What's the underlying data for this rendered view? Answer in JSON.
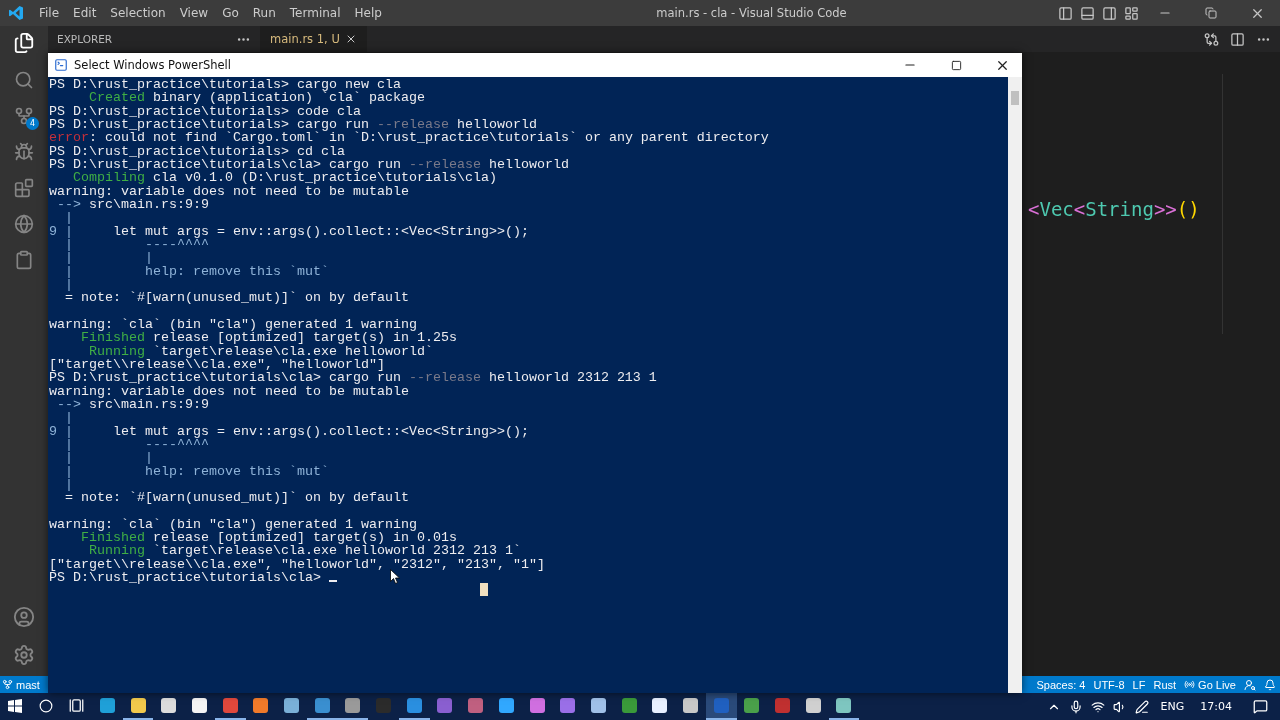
{
  "window": {
    "title": "main.rs - cla - Visual Studio Code"
  },
  "menu": [
    "File",
    "Edit",
    "Selection",
    "View",
    "Go",
    "Run",
    "Terminal",
    "Help"
  ],
  "activity_bar": {
    "source_control_badge": "4"
  },
  "sidebar": {
    "title": "EXPLORER"
  },
  "tabs": [
    {
      "label": "main.rs 1, U",
      "selected": true
    }
  ],
  "editor": {
    "tokens": [
      {
        "text": "<",
        "color": "#da70d6"
      },
      {
        "text": "Vec",
        "color": "#4ec9b0"
      },
      {
        "text": "<",
        "color": "#da70d6"
      },
      {
        "text": "String",
        "color": "#4ec9b0"
      },
      {
        "text": ">>",
        "color": "#da70d6"
      },
      {
        "text": "()",
        "color": "#ffd700"
      }
    ]
  },
  "status_bar": {
    "branch": "mast",
    "items": [
      "Spaces: 4",
      "UTF-8",
      "LF",
      "Rust"
    ],
    "go_live": "Go Live"
  },
  "powershell": {
    "title": "Select Windows PowerShell",
    "lines": [
      {
        "kind": "output",
        "segments": [
          {
            "text": "PS D:\\rust_practice\\tutorials> cargo new cla",
            "kind": "normal"
          }
        ]
      },
      {
        "kind": "output",
        "segments": [
          {
            "text": "     Created",
            "kind": "status"
          },
          {
            "text": " binary (application) `cla` package",
            "kind": "normal"
          }
        ]
      },
      {
        "kind": "output",
        "segments": [
          {
            "text": "PS D:\\rust_practice\\tutorials> code cla",
            "kind": "normal"
          }
        ]
      },
      {
        "kind": "output",
        "segments": [
          {
            "text": "PS D:\\rust_practice\\tutorials> cargo run",
            "kind": "normal"
          },
          {
            "text": " --release",
            "kind": "flag"
          },
          {
            "text": " helloworld",
            "kind": "normal"
          }
        ]
      },
      {
        "kind": "output",
        "segments": [
          {
            "text": "error",
            "kind": "error"
          },
          {
            "text": ": could not find `Cargo.toml` in `D:\\rust_practice\\tutorials` or any parent directory",
            "kind": "normal"
          }
        ]
      },
      {
        "kind": "output",
        "segments": [
          {
            "text": "PS D:\\rust_practice\\tutorials> cd cla",
            "kind": "normal"
          }
        ]
      },
      {
        "kind": "output",
        "segments": [
          {
            "text": "PS D:\\rust_practice\\tutorials\\cla> cargo run",
            "kind": "normal"
          },
          {
            "text": " --release",
            "kind": "flag"
          },
          {
            "text": " helloworld",
            "kind": "normal"
          }
        ]
      },
      {
        "kind": "output",
        "segments": [
          {
            "text": "   Compiling",
            "kind": "status"
          },
          {
            "text": " cla v0.1.0 (D:\\rust_practice\\tutorials\\cla)",
            "kind": "normal"
          }
        ]
      },
      {
        "kind": "output",
        "segments": [
          {
            "text": "warning: variable does not need to be mutable",
            "kind": "normal"
          }
        ]
      },
      {
        "kind": "output",
        "segments": [
          {
            "text": " -->",
            "kind": "gutter"
          },
          {
            "text": " src\\main.rs:9:9",
            "kind": "normal"
          }
        ]
      },
      {
        "kind": "output",
        "segments": [
          {
            "text": "  |",
            "kind": "gutter"
          }
        ]
      },
      {
        "kind": "output",
        "segments": [
          {
            "text": "9 |",
            "kind": "gutter"
          },
          {
            "text": "     let mut args = env::args().collect::<Vec<String>>();",
            "kind": "normal"
          }
        ]
      },
      {
        "kind": "output",
        "segments": [
          {
            "text": "  |",
            "kind": "gutter"
          },
          {
            "text": "         ----^^^^",
            "kind": "gutter"
          }
        ]
      },
      {
        "kind": "output",
        "segments": [
          {
            "text": "  |",
            "kind": "gutter"
          },
          {
            "text": "         |",
            "kind": "gutter"
          }
        ]
      },
      {
        "kind": "output",
        "segments": [
          {
            "text": "  |",
            "kind": "gutter"
          },
          {
            "text": "         help: remove this `mut`",
            "kind": "gutter"
          }
        ]
      },
      {
        "kind": "output",
        "segments": [
          {
            "text": "  |",
            "kind": "gutter"
          }
        ]
      },
      {
        "kind": "output",
        "segments": [
          {
            "text": "  = note: `#[warn(unused_mut)]` on by default",
            "kind": "normal"
          }
        ]
      },
      {
        "kind": "blank"
      },
      {
        "kind": "output",
        "segments": [
          {
            "text": "warning: `cla` (bin \"cla\") generated 1 warning",
            "kind": "normal"
          }
        ]
      },
      {
        "kind": "output",
        "segments": [
          {
            "text": "    Finished",
            "kind": "status"
          },
          {
            "text": " release [optimized] target(s) in 1.25s",
            "kind": "normal"
          }
        ]
      },
      {
        "kind": "output",
        "segments": [
          {
            "text": "     Running",
            "kind": "status"
          },
          {
            "text": " `target\\release\\cla.exe helloworld`",
            "kind": "normal"
          }
        ]
      },
      {
        "kind": "output",
        "segments": [
          {
            "text": "[\"target\\\\release\\\\cla.exe\", \"helloworld\"]",
            "kind": "normal"
          }
        ]
      },
      {
        "kind": "output",
        "segments": [
          {
            "text": "PS D:\\rust_practice\\tutorials\\cla> cargo run",
            "kind": "normal"
          },
          {
            "text": " --release",
            "kind": "flag"
          },
          {
            "text": " helloworld 2312 213 1",
            "kind": "normal"
          }
        ]
      },
      {
        "kind": "output",
        "segments": [
          {
            "text": "warning: variable does not need to be mutable",
            "kind": "normal"
          }
        ]
      },
      {
        "kind": "output",
        "segments": [
          {
            "text": " -->",
            "kind": "gutter"
          },
          {
            "text": " src\\main.rs:9:9",
            "kind": "normal"
          }
        ]
      },
      {
        "kind": "output",
        "segments": [
          {
            "text": "  |",
            "kind": "gutter"
          }
        ]
      },
      {
        "kind": "output",
        "segments": [
          {
            "text": "9 |",
            "kind": "gutter"
          },
          {
            "text": "     let mut args = env::args().collect::<Vec<String>>();",
            "kind": "normal"
          }
        ]
      },
      {
        "kind": "output",
        "segments": [
          {
            "text": "  |",
            "kind": "gutter"
          },
          {
            "text": "         ----^^^^",
            "kind": "gutter"
          }
        ]
      },
      {
        "kind": "output",
        "segments": [
          {
            "text": "  |",
            "kind": "gutter"
          },
          {
            "text": "         |",
            "kind": "gutter"
          }
        ]
      },
      {
        "kind": "output",
        "segments": [
          {
            "text": "  |",
            "kind": "gutter"
          },
          {
            "text": "         help: remove this `mut`",
            "kind": "gutter"
          }
        ]
      },
      {
        "kind": "output",
        "segments": [
          {
            "text": "  |",
            "kind": "gutter"
          }
        ]
      },
      {
        "kind": "output",
        "segments": [
          {
            "text": "  = note: `#[warn(unused_mut)]` on by default",
            "kind": "normal"
          }
        ]
      },
      {
        "kind": "blank"
      },
      {
        "kind": "output",
        "segments": [
          {
            "text": "warning: `cla` (bin \"cla\") generated 1 warning",
            "kind": "normal"
          }
        ]
      },
      {
        "kind": "output",
        "segments": [
          {
            "text": "    Finished",
            "kind": "status"
          },
          {
            "text": " release [optimized] target(s) in 0.01s",
            "kind": "normal"
          }
        ]
      },
      {
        "kind": "output",
        "segments": [
          {
            "text": "     Running",
            "kind": "status"
          },
          {
            "text": " `target\\release\\cla.exe helloworld 2312 213 1`",
            "kind": "normal"
          }
        ]
      },
      {
        "kind": "output",
        "segments": [
          {
            "text": "[\"target\\\\release\\\\cla.exe\", \"helloworld\", \"2312\", \"213\", \"1\"]",
            "kind": "normal"
          }
        ]
      },
      {
        "kind": "prompt",
        "segments": [
          {
            "text": "PS D:\\rust_practice\\tutorials\\cla> ",
            "kind": "normal"
          }
        ]
      }
    ]
  },
  "taskbar": {
    "apps": [
      {
        "color": "#1fa0d8",
        "running": false,
        "selected": false
      },
      {
        "color": "#f2c94c",
        "running": true,
        "selected": false
      },
      {
        "color": "#dcdcdc",
        "running": false,
        "selected": false
      },
      {
        "color": "#f4f4f4",
        "running": false,
        "selected": false
      },
      {
        "color": "#e0483c",
        "running": true,
        "selected": false
      },
      {
        "color": "#f07a2a",
        "running": false,
        "selected": false
      },
      {
        "color": "#7ab0d8",
        "running": false,
        "selected": false
      },
      {
        "color": "#3a8fd0",
        "running": true,
        "selected": false
      },
      {
        "color": "#9a9a9a",
        "running": true,
        "selected": false
      },
      {
        "color": "#2b2b2b",
        "running": false,
        "selected": false
      },
      {
        "color": "#2a8fe0",
        "running": true,
        "selected": false
      },
      {
        "color": "#8a5fd0",
        "running": false,
        "selected": false
      },
      {
        "color": "#c06080",
        "running": false,
        "selected": false
      },
      {
        "color": "#31a8ff",
        "running": false,
        "selected": false
      },
      {
        "color": "#d06fe0",
        "running": false,
        "selected": false
      },
      {
        "color": "#9a6fe8",
        "running": false,
        "selected": false
      },
      {
        "color": "#a0c0e8",
        "running": false,
        "selected": false
      },
      {
        "color": "#3a9a3a",
        "running": false,
        "selected": false
      },
      {
        "color": "#e8f0ff",
        "running": false,
        "selected": false
      },
      {
        "color": "#c8c8c8",
        "running": false,
        "selected": false
      },
      {
        "color": "#2060c0",
        "running": true,
        "selected": true
      },
      {
        "color": "#4aa04a",
        "running": false,
        "selected": false
      },
      {
        "color": "#c03030",
        "running": false,
        "selected": false
      },
      {
        "color": "#d0d0d0",
        "running": false,
        "selected": false
      },
      {
        "color": "#7ec6c0",
        "running": true,
        "selected": false
      }
    ],
    "language": "ENG",
    "time": "17:04"
  }
}
